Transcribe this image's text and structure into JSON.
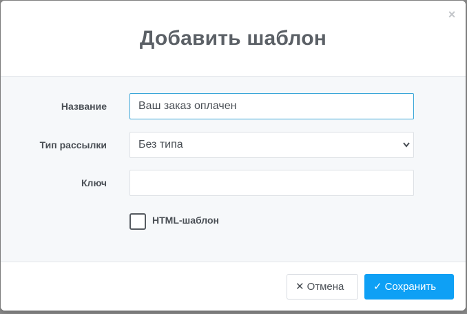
{
  "modal": {
    "title": "Добавить шаблон",
    "close_icon": "×"
  },
  "form": {
    "name": {
      "label": "Название",
      "value": "Ваш заказ оплачен"
    },
    "mailing_type": {
      "label": "Тип рассылки",
      "selected": "Без типа"
    },
    "key": {
      "label": "Ключ",
      "value": ""
    },
    "html_template": {
      "label": "HTML-шаблон",
      "checked": false
    }
  },
  "footer": {
    "cancel_icon": "✕",
    "cancel_label": "Отмена",
    "save_icon": "✓",
    "save_label": "Сохранить"
  },
  "colors": {
    "accent": "#0ea0f5",
    "focus_border": "#3aa6d8",
    "title_text": "#5b6066",
    "body_bg": "#f6f8fa"
  }
}
